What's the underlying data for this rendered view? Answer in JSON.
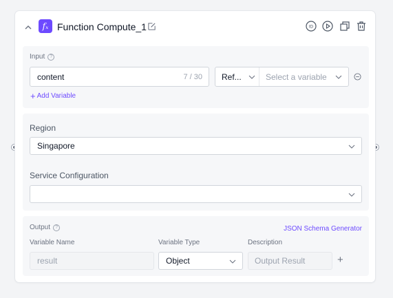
{
  "node": {
    "title": "Function Compute_1",
    "icon_glyph": "fₓ",
    "accent": "#6d4aff"
  },
  "header_actions": [
    "id-icon",
    "play-icon",
    "copy-icon",
    "trash-icon"
  ],
  "header_id_label": "ID",
  "input": {
    "label": "Input",
    "variable_name": "content",
    "char_count": "7 / 30",
    "ref_type": "Ref...",
    "variable_placeholder": "Select a variable",
    "add_variable": "Add Variable"
  },
  "region": {
    "label": "Region",
    "value": "Singapore"
  },
  "service": {
    "label": "Service Configuration",
    "value": ""
  },
  "output": {
    "label": "Output",
    "schema_link": "JSON Schema Generator",
    "columns": {
      "name": "Variable Name",
      "type": "Variable Type",
      "desc": "Description"
    },
    "row": {
      "name_placeholder": "result",
      "type": "Object",
      "desc_placeholder": "Output Result"
    }
  }
}
